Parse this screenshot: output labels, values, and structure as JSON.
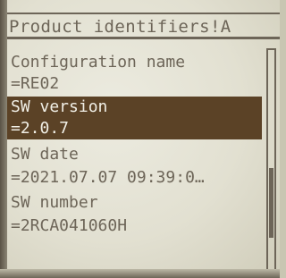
{
  "title_bar": {
    "title": "Product identifiers!A"
  },
  "items": [
    {
      "label": "Configuration name",
      "value": "=RE02",
      "selected": false
    },
    {
      "label": "SW version",
      "value": "=2.0.7",
      "selected": true
    },
    {
      "label": "SW date",
      "value": "=2021.07.07 09:39:0…",
      "selected": false
    },
    {
      "label": "SW number",
      "value": "=2RCA041060H",
      "selected": false
    }
  ]
}
